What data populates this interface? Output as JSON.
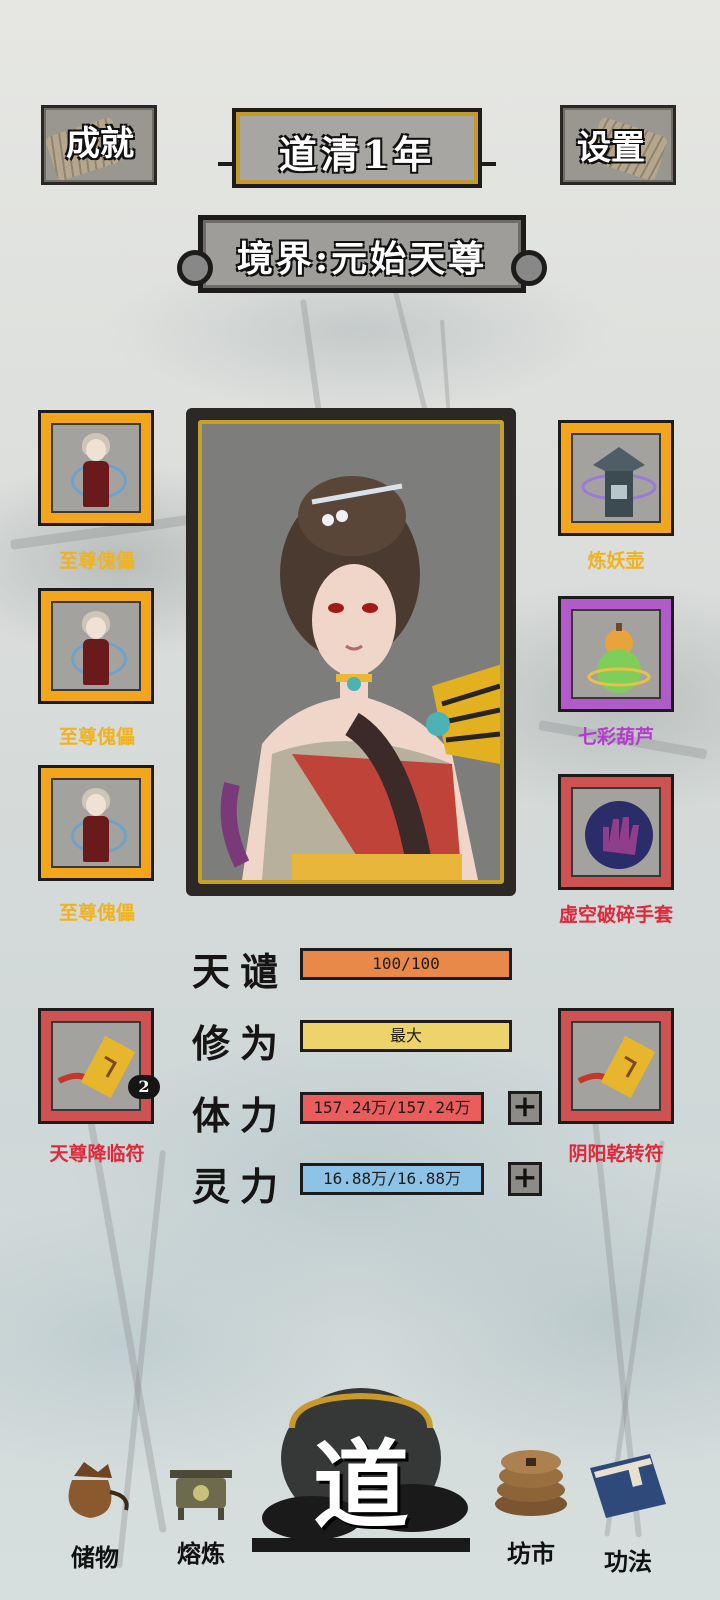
{
  "header": {
    "achievements_label": "成就",
    "settings_label": "设置",
    "era_label": "道清1年",
    "realm_label": "境界:元始天尊"
  },
  "equipment": {
    "left": [
      {
        "name": "至尊傀儡",
        "rarity": "orange"
      },
      {
        "name": "至尊傀儡",
        "rarity": "orange"
      },
      {
        "name": "至尊傀儡",
        "rarity": "orange"
      }
    ],
    "right": [
      {
        "name": "炼妖壶",
        "rarity": "orange"
      },
      {
        "name": "七彩葫芦",
        "rarity": "purple"
      },
      {
        "name": "虚空破碎手套",
        "rarity": "red"
      }
    ],
    "talismans": [
      {
        "name": "天尊降临符",
        "count": "2"
      },
      {
        "name": "阴阳乾转符"
      }
    ]
  },
  "stats": {
    "tribulation": {
      "label": "天谴",
      "value": "100/100",
      "color": "#e8894a",
      "fill": 1.0
    },
    "cultivation": {
      "label": "修为",
      "value": "最大",
      "color": "#ecd36a",
      "fill": 1.0
    },
    "stamina": {
      "label": "体力",
      "value": "157.24万/157.24万",
      "color": "#e95d5d",
      "fill": 1.0
    },
    "spirit": {
      "label": "灵力",
      "value": "16.88万/16.88万",
      "color": "#8ec3e8",
      "fill": 1.0
    },
    "plus_symbol": "+"
  },
  "nav": {
    "storage": "储物",
    "smelt": "熔炼",
    "dao": "道",
    "market": "坊市",
    "skills": "功法"
  }
}
